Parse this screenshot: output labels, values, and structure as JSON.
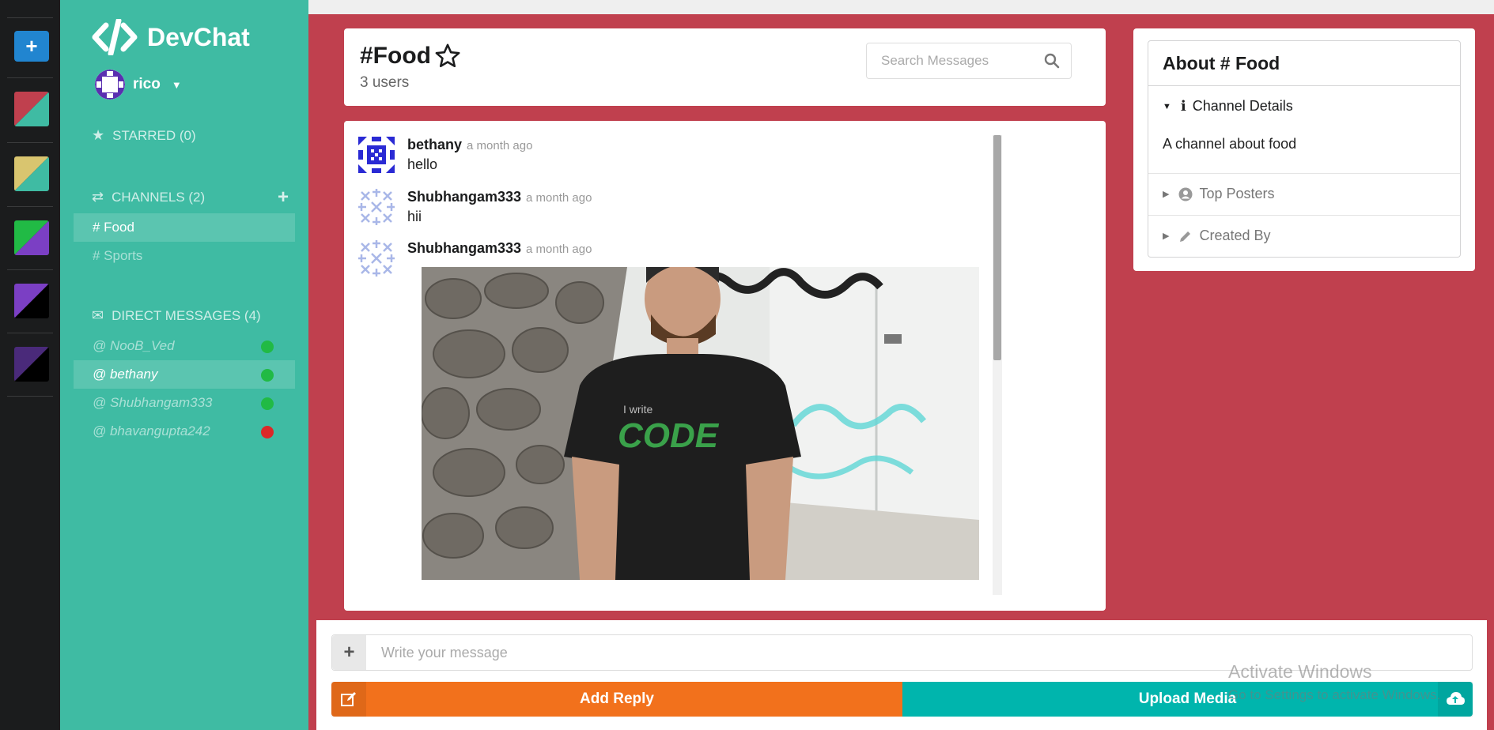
{
  "app": {
    "name": "DevChat"
  },
  "user": {
    "name": "rico"
  },
  "sidebar": {
    "starred_label": "STARRED (0)",
    "channels_label": "CHANNELS (2)",
    "channels": [
      {
        "label": "# Food"
      },
      {
        "label": "# Sports"
      }
    ],
    "dm_label": "DIRECT MESSAGES (4)",
    "direct_messages": [
      {
        "label": "@ NooB_Ved",
        "status": "online"
      },
      {
        "label": "@ bethany",
        "status": "online"
      },
      {
        "label": "@ Shubhangam333",
        "status": "online"
      },
      {
        "label": "@ bhavangupta242",
        "status": "offline"
      }
    ]
  },
  "header": {
    "channel_title": "#Food",
    "user_count": "3 users",
    "search_placeholder": "Search Messages"
  },
  "messages": [
    {
      "author": "bethany",
      "time": "a month ago",
      "text": "hello"
    },
    {
      "author": "Shubhangam333",
      "time": "a month ago",
      "text": "hii"
    },
    {
      "author": "Shubhangam333",
      "time": "a month ago",
      "image_text_1": "I write",
      "image_text_2": "CODE"
    }
  ],
  "about": {
    "title": "About # Food",
    "sections": [
      {
        "label": "Channel Details",
        "icon": "info-icon",
        "expanded": true,
        "content": "A channel about food"
      },
      {
        "label": "Top Posters",
        "icon": "user-circle-icon",
        "expanded": false
      },
      {
        "label": "Created By",
        "icon": "pencil-icon",
        "expanded": false
      }
    ]
  },
  "form": {
    "message_placeholder": "Write your message",
    "reply_label": "Add Reply",
    "upload_label": "Upload Media"
  },
  "watermark": {
    "line1": "Activate Windows",
    "line2": "Go to Settings to activate Windows."
  },
  "colors": {
    "primary": "#3fbba3",
    "secondary": "#c0404e",
    "reply_button": "#f2711c",
    "upload_button": "#00b5ad",
    "online": "#21ba45",
    "offline": "#db2828"
  }
}
